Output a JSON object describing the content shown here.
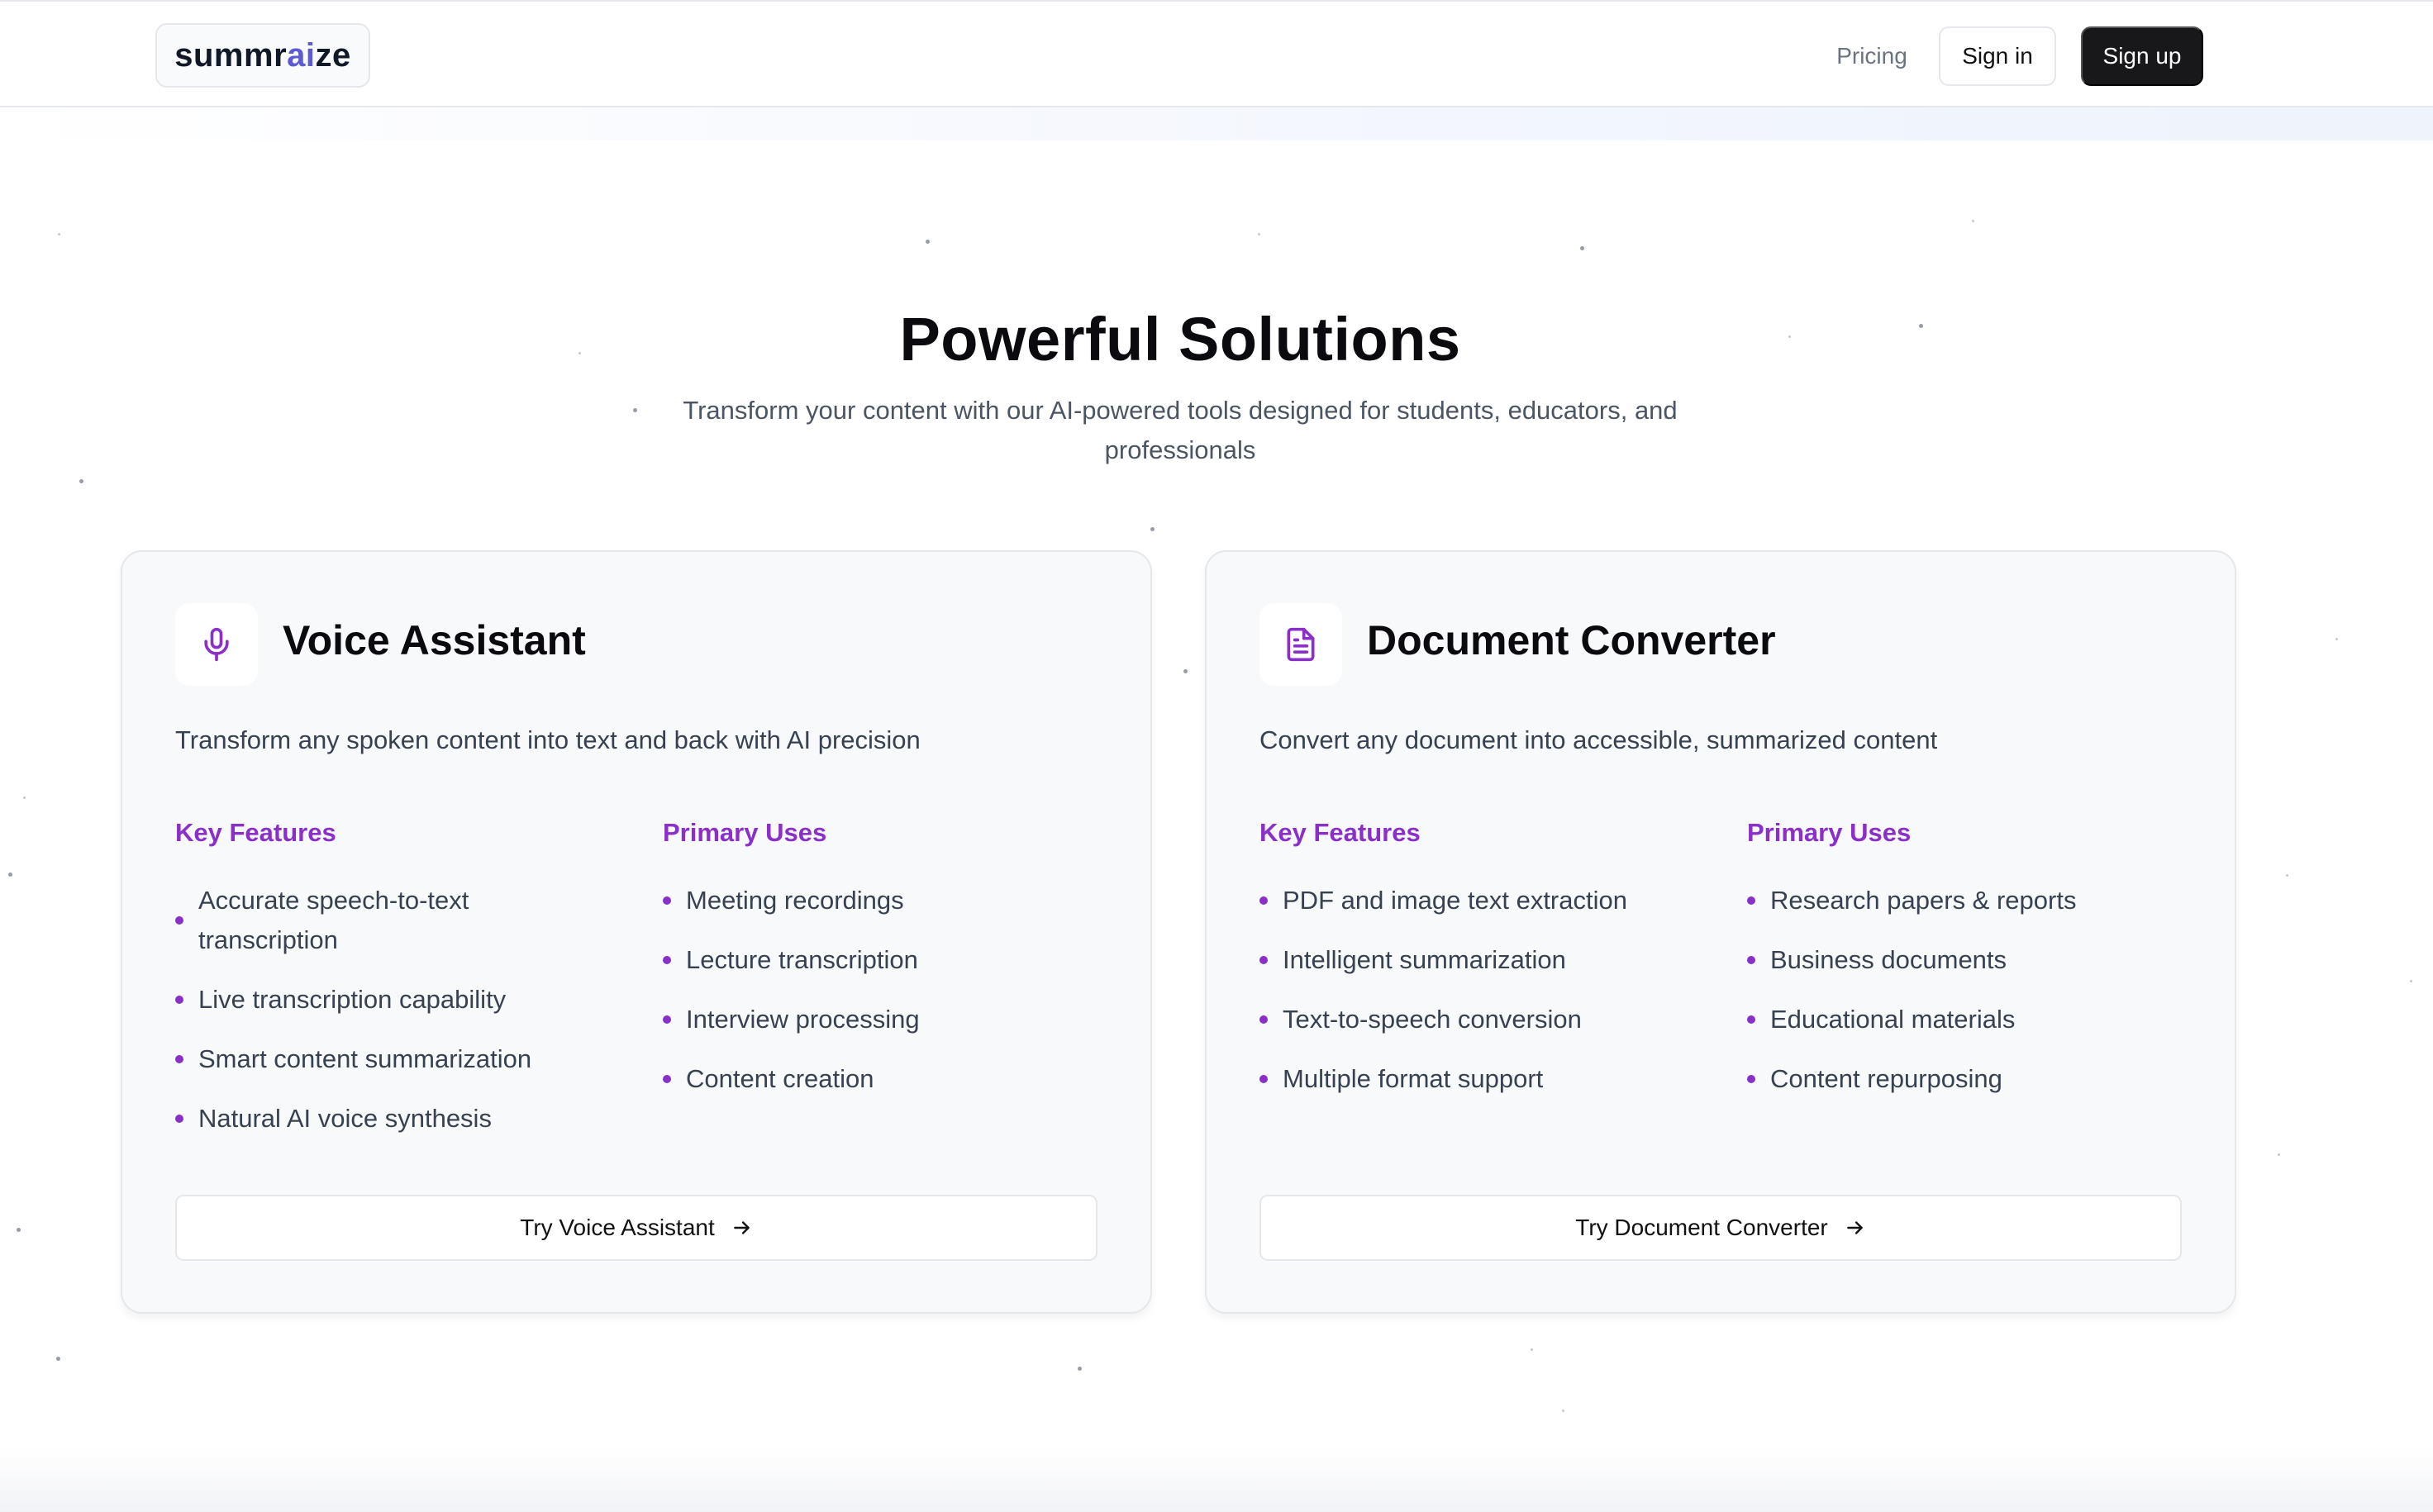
{
  "header": {
    "logo": {
      "pre": "summr",
      "accent": "ai",
      "post": "ze",
      "accent_color": "#5b5bd6"
    },
    "nav": {
      "pricing": "Pricing"
    },
    "signin_label": "Sign in",
    "signup_label": "Sign up"
  },
  "hero": {
    "title": "Powerful Solutions",
    "subtitle": "Transform your content with our AI-powered tools designed for students, educators, and professionals"
  },
  "cards": [
    {
      "icon": "microphone-icon",
      "title": "Voice Assistant",
      "description": "Transform any spoken content into text and back with AI precision",
      "features_heading": "Key Features",
      "features": [
        "Accurate speech-to-text transcription",
        "Live transcription capability",
        "Smart content summarization",
        "Natural AI voice synthesis"
      ],
      "uses_heading": "Primary Uses",
      "uses": [
        "Meeting recordings",
        "Lecture transcription",
        "Interview processing",
        "Content creation"
      ],
      "button_label": "Try Voice Assistant",
      "button_icon": "arrow-right-icon"
    },
    {
      "icon": "document-icon",
      "title": "Document Converter",
      "description": "Convert any document into accessible, summarized content",
      "features_heading": "Key Features",
      "features": [
        "PDF and image text extraction",
        "Intelligent summarization",
        "Text-to-speech conversion",
        "Multiple format support"
      ],
      "uses_heading": "Primary Uses",
      "uses": [
        "Research papers & reports",
        "Business documents",
        "Educational materials",
        "Content repurposing"
      ],
      "button_label": "Try Document Converter",
      "button_icon": "arrow-right-icon"
    }
  ],
  "colors": {
    "accent_purple": "#8b2fc9",
    "signup_bg": "#18181b"
  }
}
